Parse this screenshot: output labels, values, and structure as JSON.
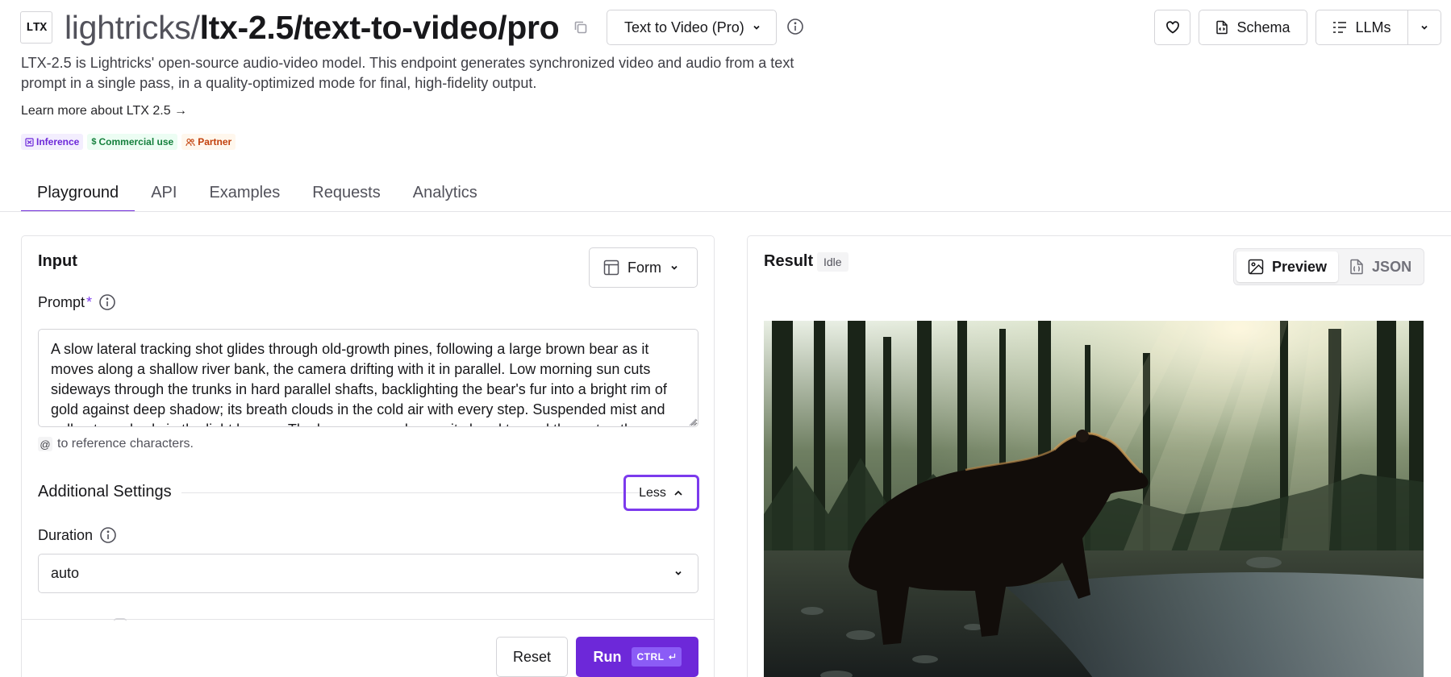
{
  "header": {
    "logo_text": "LTX",
    "title_owner": "lightricks/",
    "title_model": "ltx-2.5/text-to-video/pro",
    "variant_select": "Text to Video (Pro)",
    "favorite_icon": "heart-icon",
    "schema_label": "Schema",
    "llms_label": "LLMs"
  },
  "description": "LTX-2.5 is Lightricks' open-source audio-video model. This endpoint generates synchronized video and audio from a text prompt in a single pass, in a quality-optimized mode for final, high-fidelity output.",
  "learn_more": "Learn more about LTX 2.5 →",
  "badges": [
    {
      "label": "Inference",
      "icon": "inference-icon"
    },
    {
      "label": "Commercial use",
      "icon": "dollar-icon"
    },
    {
      "label": "Partner",
      "icon": "partner-icon"
    }
  ],
  "tabs": [
    "Playground",
    "API",
    "Examples",
    "Requests",
    "Analytics"
  ],
  "active_tab": "Playground",
  "input": {
    "title": "Input",
    "mode_select": "Form",
    "prompt_label": "Prompt",
    "prompt_required_mark": "*",
    "prompt_value": "A slow lateral tracking shot glides through old-growth pines, following a large brown bear as it moves along a shallow river bank, the camera drifting with it in parallel. Low morning sun cuts sideways through the trunks in hard parallel shafts, backlighting the bear's fur into a bright rim of gold against deep shadow; its breath clouds in the cold air with every step. Suspended mist and pollen turn slowly in the light beams. The bear pauses, lowers its head toward the water, then",
    "ref_hint_symbol": "@",
    "ref_hint": "to reference characters.",
    "additional_settings": "Additional Settings",
    "less_label": "Less",
    "duration_label": "Duration",
    "duration_value": "auto",
    "reset_label": "Reset",
    "run_label": "Run",
    "run_shortcut": "CTRL"
  },
  "result": {
    "title": "Result",
    "status": "Idle",
    "preview_label": "Preview",
    "json_label": "JSON",
    "active_view": "Preview"
  },
  "colors": {
    "accent": "#6d28d9",
    "focus_ring": "#7c3aed"
  }
}
